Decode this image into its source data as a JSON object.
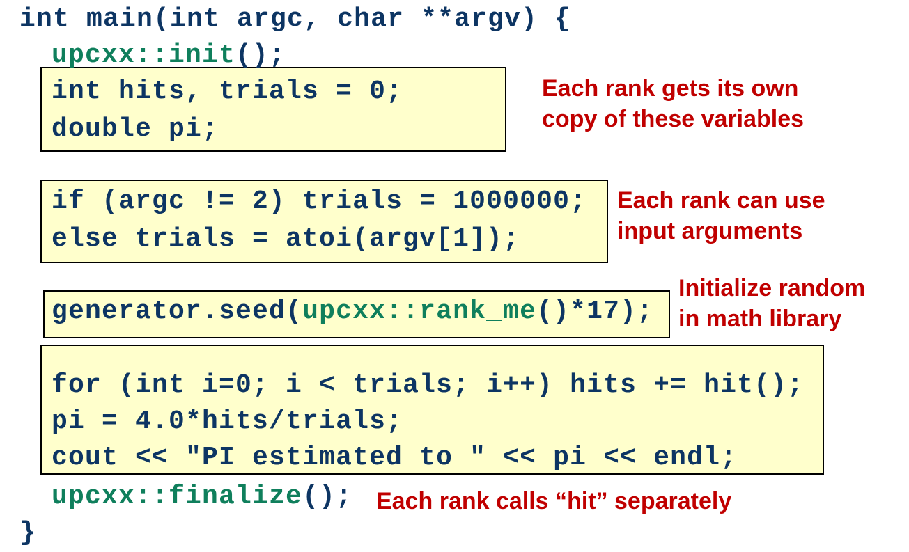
{
  "code": {
    "l1": "int main(int argc, char **argv) {",
    "init_fn": "upcxx::init",
    "init_tail": "();",
    "l3": "int hits, trials = 0;",
    "l4": "double pi;",
    "l5": "if (argc != 2) trials = 1000000;",
    "l6": "else trials = atoi(argv[1]);",
    "seed_head": "generator.seed(",
    "seed_fn": "upcxx::rank_me",
    "seed_tail": "()*17);",
    "l8": "for (int i=0; i < trials; i++) hits += hit();",
    "l9": "pi = 4.0*hits/trials;",
    "l10": "cout << \"PI estimated to \" << pi << endl;",
    "fin_fn": "upcxx::finalize",
    "fin_tail": "();",
    "close": "}"
  },
  "notes": {
    "vars": [
      "Each rank gets its own",
      "copy of these variables"
    ],
    "args": [
      "Each rank can use",
      "input arguments"
    ],
    "random": [
      "Initialize random",
      "in math library"
    ],
    "hit": "Each rank calls “hit” separately"
  },
  "colors": {
    "code": "#0d3563",
    "upcxx": "#0f7f5c",
    "note": "#c00000",
    "box": "#ffffcc"
  }
}
